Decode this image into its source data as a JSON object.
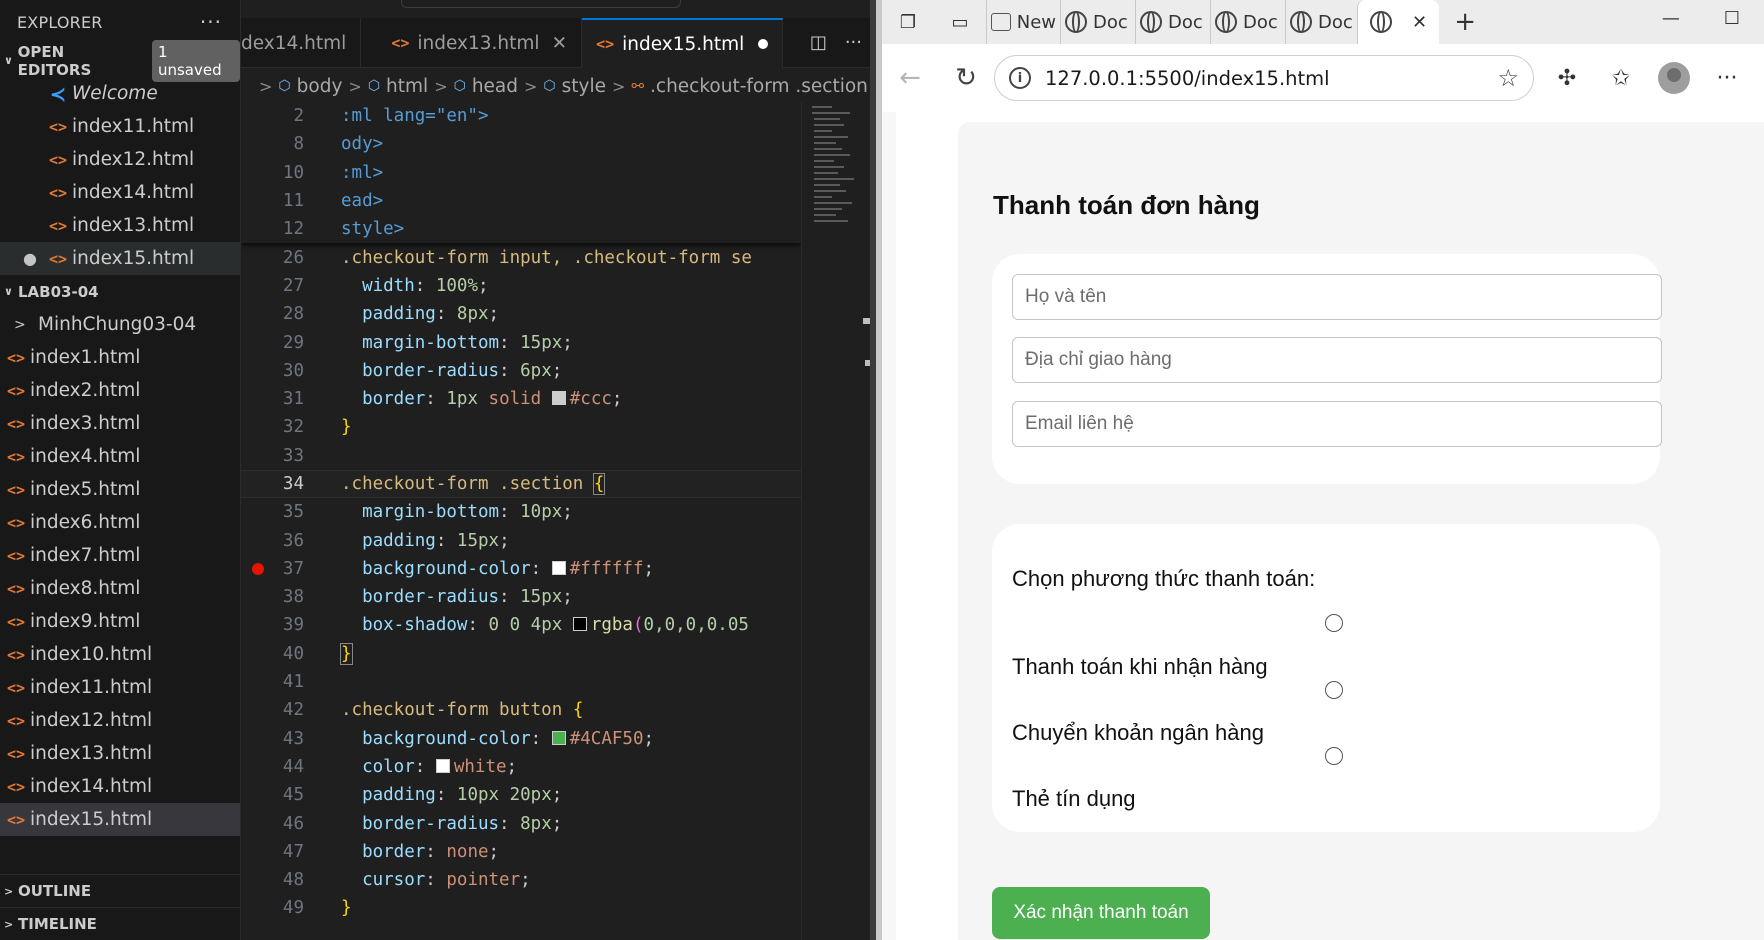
{
  "vscode": {
    "explorer_title": "EXPLORER",
    "open_editors": {
      "label": "OPEN EDITORS",
      "badge": "1 unsaved"
    },
    "open_files": [
      "Welcome",
      "index11.html",
      "index12.html",
      "index14.html",
      "index13.html",
      "index15.html"
    ],
    "workspace": "LAB03-04",
    "folder": "MinhChung03-04",
    "files": [
      "index1.html",
      "index2.html",
      "index3.html",
      "index4.html",
      "index5.html",
      "index6.html",
      "index7.html",
      "index8.html",
      "index9.html",
      "index10.html",
      "index11.html",
      "index12.html",
      "index13.html",
      "index14.html",
      "index15.html"
    ],
    "outline": "OUTLINE",
    "timeline": "TIMELINE",
    "tabs": [
      "dex14.html",
      "index13.html",
      "index15.html"
    ],
    "breadcrumb": [
      "body",
      "html",
      "head",
      "style",
      ".checkout-form .section"
    ],
    "sticky_lines": [
      {
        "n": "2",
        "text": ":ml lang=\"en\">"
      },
      {
        "n": "8",
        "text": "ody>"
      },
      {
        "n": "10",
        "text": ":ml>"
      },
      {
        "n": "11",
        "text": "ead>"
      },
      {
        "n": "12",
        "text": "style>"
      }
    ],
    "lines": [
      "26",
      "27",
      "28",
      "29",
      "30",
      "31",
      "32",
      "33",
      "34",
      "35",
      "36",
      "37",
      "38",
      "39",
      "40",
      "41",
      "42",
      "43",
      "44",
      "45",
      "46",
      "47",
      "48",
      "49"
    ]
  },
  "browser": {
    "tabs": [
      "New",
      "Doc",
      "Doc",
      "Doc",
      "Doc"
    ],
    "url": "127.0.0.1:5500/index15.html",
    "page": {
      "title": "Thanh toán đơn hàng",
      "inputs": [
        "Họ và tên",
        "Địa chỉ giao hàng",
        "Email liên hệ"
      ],
      "payment_label": "Chọn phương thức thanh toán:",
      "options": [
        "Thanh toán khi nhận hàng",
        "Chuyển khoản ngân hàng",
        "Thẻ tín dụng"
      ],
      "confirm": "Xác nhận thanh toán"
    }
  },
  "colors": {
    "accent_green": "#4CAF50",
    "vscode_blue": "#0078d4"
  }
}
